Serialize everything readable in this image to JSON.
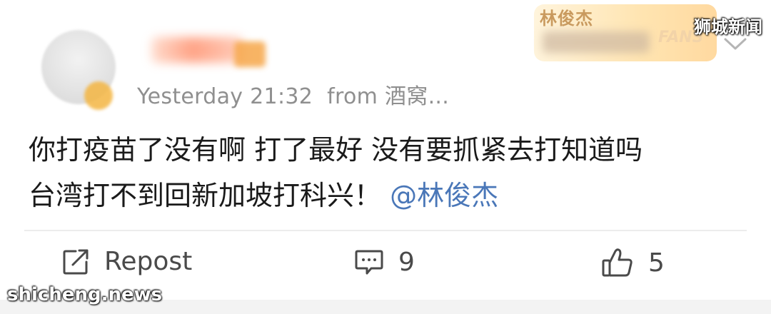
{
  "post": {
    "timestamp": "Yesterday 21:32",
    "source_prefix": "from",
    "source": "酒窝...",
    "content_line1": "你打疫苗了没有啊 打了最好 没有要抓紧去打知道吗",
    "content_line2": "台湾打不到回新加坡打科兴！",
    "mention": "@林俊杰",
    "mention_color": "#4a77b8"
  },
  "fan_badge": {
    "name": "林俊杰",
    "label": "FANS"
  },
  "actions": {
    "repost_label": "Repost",
    "comment_count": "9",
    "like_count": "5"
  },
  "watermarks": {
    "top_right": "狮城新闻",
    "bottom_left": "shicheng.news"
  }
}
